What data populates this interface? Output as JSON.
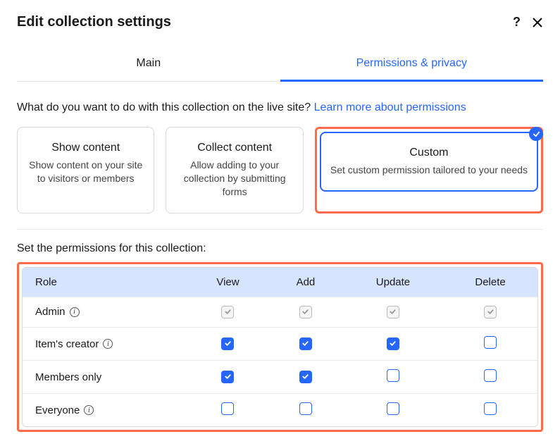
{
  "dialog": {
    "title": "Edit collection settings"
  },
  "tabs": {
    "main": "Main",
    "permissions": "Permissions & privacy"
  },
  "intro": {
    "text": "What do you want to do with this collection on the live site?",
    "link": "Learn more about permissions"
  },
  "cards": {
    "show": {
      "title": "Show content",
      "desc": "Show content on your site to visitors or members"
    },
    "collect": {
      "title": "Collect content",
      "desc": "Allow adding to your collection by submitting forms"
    },
    "custom": {
      "title": "Custom",
      "desc": "Set custom permission tailored to your needs"
    }
  },
  "permissions": {
    "label": "Set the permissions for this collection:",
    "columns": {
      "role": "Role",
      "view": "View",
      "add": "Add",
      "update": "Update",
      "delete": "Delete"
    },
    "rows": [
      {
        "role": "Admin",
        "info": true,
        "view": "locked",
        "add": "locked",
        "update": "locked",
        "delete": "locked"
      },
      {
        "role": "Item's creator",
        "info": true,
        "view": "checked",
        "add": "checked",
        "update": "checked",
        "delete": "unchecked"
      },
      {
        "role": "Members only",
        "info": false,
        "view": "checked",
        "add": "checked",
        "update": "unchecked",
        "delete": "unchecked"
      },
      {
        "role": "Everyone",
        "info": true,
        "view": "unchecked",
        "add": "unchecked",
        "update": "unchecked",
        "delete": "unchecked"
      }
    ]
  }
}
